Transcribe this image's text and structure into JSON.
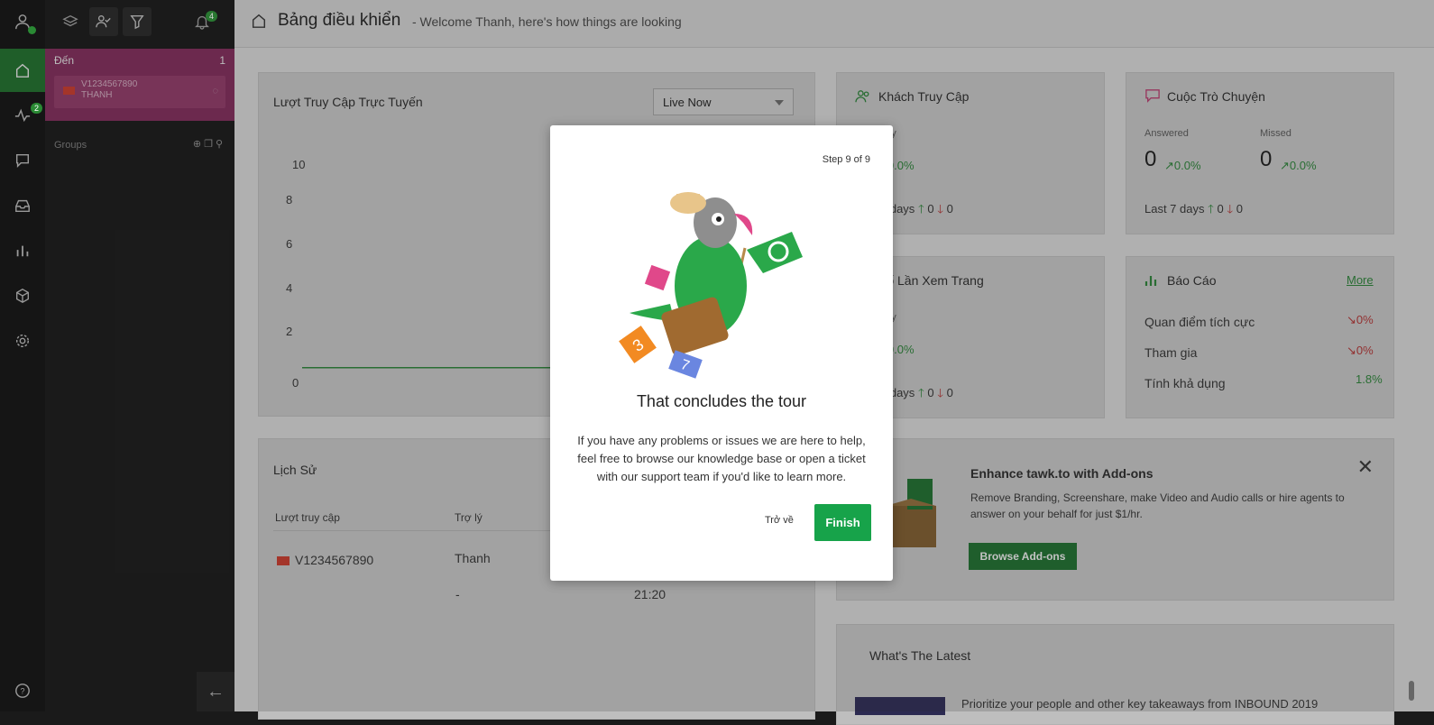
{
  "rail": {
    "pulse_badge": "2"
  },
  "panel": {
    "notif_badge": "4",
    "incoming_title": "Đến",
    "incoming_count": "1",
    "visitor_line1": "V1234567890",
    "visitor_line2": "THANH",
    "groups_label": "Groups"
  },
  "header": {
    "title": "Bảng điều khiển",
    "subtitle": "- Welcome Thanh, here's how things are looking"
  },
  "online": {
    "title": "Lượt Truy Cập Trực Tuyến",
    "dropdown_value": "Live Now",
    "y_labels": [
      "10",
      "8",
      "6",
      "4",
      "2",
      "0"
    ]
  },
  "chart_data": {
    "type": "line",
    "title": "Lượt Truy Cập Trực Tuyến",
    "ylim": [
      0,
      10
    ],
    "yticks": [
      "0",
      "2",
      "4",
      "6",
      "8",
      "10"
    ],
    "series": [
      {
        "values": [
          1,
          1,
          1,
          1,
          1,
          1,
          1,
          1,
          1,
          1,
          2
        ]
      }
    ]
  },
  "visitors": {
    "title": "Khách Truy Cập",
    "today_label": "nay",
    "pct": "0.0%",
    "last7": "7 days",
    "up": "0",
    "down": "0"
  },
  "chats": {
    "title": "Cuộc Trò Chuyện",
    "answered_label": "Answered",
    "answered_value": "0",
    "answered_pct": "0.0%",
    "missed_label": "Missed",
    "missed_value": "0",
    "missed_pct": "0.0%",
    "last7": "Last 7 days",
    "up": "0",
    "down": "0"
  },
  "pageviews": {
    "title": "Số Lần Xem Trang",
    "today_label": "nay",
    "pct": "0.0%",
    "last7": "7 days",
    "up": "0",
    "down": "0"
  },
  "reports": {
    "title": "Báo Cáo",
    "more": "More",
    "rows": [
      {
        "label": "Quan điểm tích cực",
        "value": "0%"
      },
      {
        "label": "Tham gia",
        "value": "0%"
      },
      {
        "label": "Tính khả dụng",
        "value": "1.8%"
      }
    ]
  },
  "history": {
    "title": "Lịch Sử",
    "col_visits": "Lượt truy cập",
    "col_agent": "Trợ lý",
    "row1_visitor": "V1234567890",
    "row1_agent": "Thanh",
    "row2_agent": "-",
    "row2_time": "21:20"
  },
  "addons": {
    "title": "Enhance tawk.to with Add-ons",
    "desc": "Remove Branding, Screenshare, make Video and Audio calls or hire agents to answer on your behalf for just $1/hr.",
    "button": "Browse Add-ons"
  },
  "latest": {
    "title": "What's The Latest",
    "item": "Prioritize your people and other key takeaways from INBOUND 2019"
  },
  "modal": {
    "step": "Step 9 of 9",
    "title": "That concludes the tour",
    "body": "If you have any problems or issues we are here to help, feel free to browse our knowledge base or open a ticket with our support team if you'd like to learn more.",
    "back": "Trở về",
    "finish": "Finish"
  }
}
